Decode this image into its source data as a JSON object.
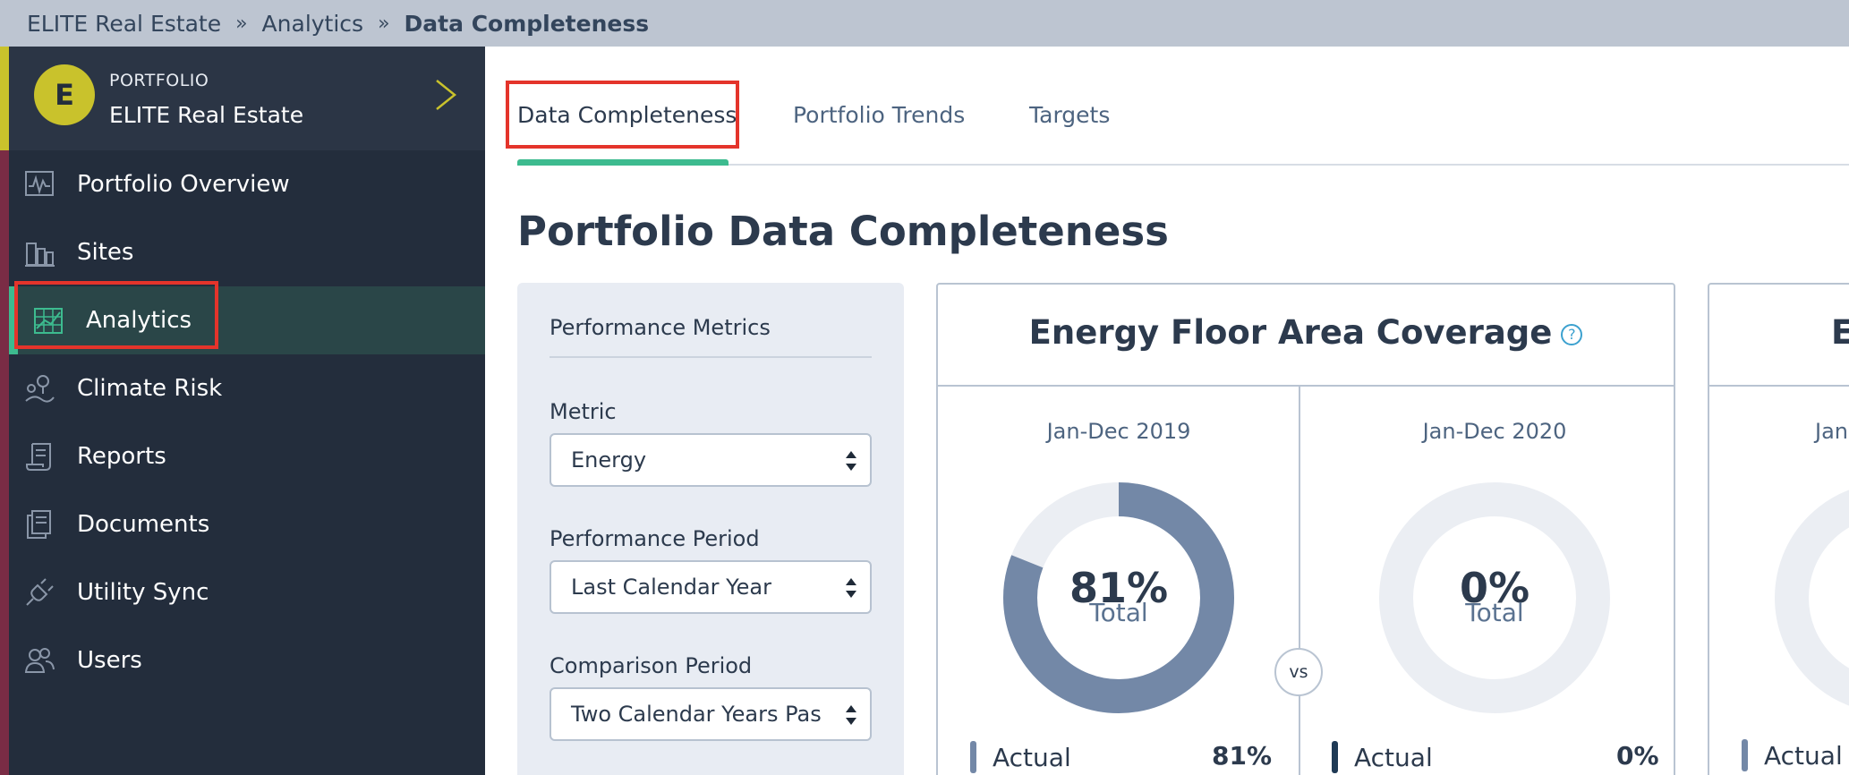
{
  "breadcrumb": {
    "items": [
      "ELITE Real Estate",
      "Analytics"
    ],
    "separator": "»",
    "current": "Data Completeness"
  },
  "sidebar": {
    "avatar_letter": "E",
    "portfolio_label": "PORTFOLIO",
    "portfolio_name": "ELITE Real Estate",
    "items": [
      {
        "label": "Portfolio Overview",
        "icon": "chart-monitor-icon"
      },
      {
        "label": "Sites",
        "icon": "buildings-icon"
      },
      {
        "label": "Analytics",
        "icon": "analytics-icon",
        "active": true
      },
      {
        "label": "Climate Risk",
        "icon": "map-pin-icon"
      },
      {
        "label": "Reports",
        "icon": "scroll-icon"
      },
      {
        "label": "Documents",
        "icon": "documents-icon"
      },
      {
        "label": "Utility Sync",
        "icon": "plug-icon"
      },
      {
        "label": "Users",
        "icon": "users-icon"
      }
    ]
  },
  "tabs": [
    {
      "label": "Data Completeness",
      "active": true
    },
    {
      "label": "Portfolio Trends"
    },
    {
      "label": "Targets"
    }
  ],
  "page_title": "Portfolio Data Completeness",
  "metrics_panel": {
    "title": "Performance Metrics",
    "fields": [
      {
        "label": "Metric",
        "value": "Energy"
      },
      {
        "label": "Performance Period",
        "value": "Last Calendar Year"
      },
      {
        "label": "Comparison Period",
        "value": "Two Calendar Years Pas"
      }
    ]
  },
  "coverage_card": {
    "title": "Energy Floor Area Coverage",
    "help_icon": "?",
    "vs_label": "vs",
    "periods": [
      {
        "label": "Jan-Dec 2019",
        "percent": 81,
        "percent_text": "81%",
        "total_label": "Total",
        "legend_label": "Actual",
        "legend_value": "81%",
        "legend_color": "#7388a7"
      },
      {
        "label": "Jan-Dec 2020",
        "percent": 0,
        "percent_text": "0%",
        "total_label": "Total",
        "legend_label": "Actual",
        "legend_value": "0%",
        "legend_color": "#1f3a55"
      }
    ]
  },
  "second_card": {
    "title_fragment": "E",
    "period_fragment": "Jan",
    "legend_label": "Actual"
  },
  "colors": {
    "accent": "#3dbb8f",
    "donut_fill": "#7388a7",
    "donut_track": "#ebeef3",
    "highlight": "#e4342b",
    "sidebar_bg": "#232d3c"
  }
}
